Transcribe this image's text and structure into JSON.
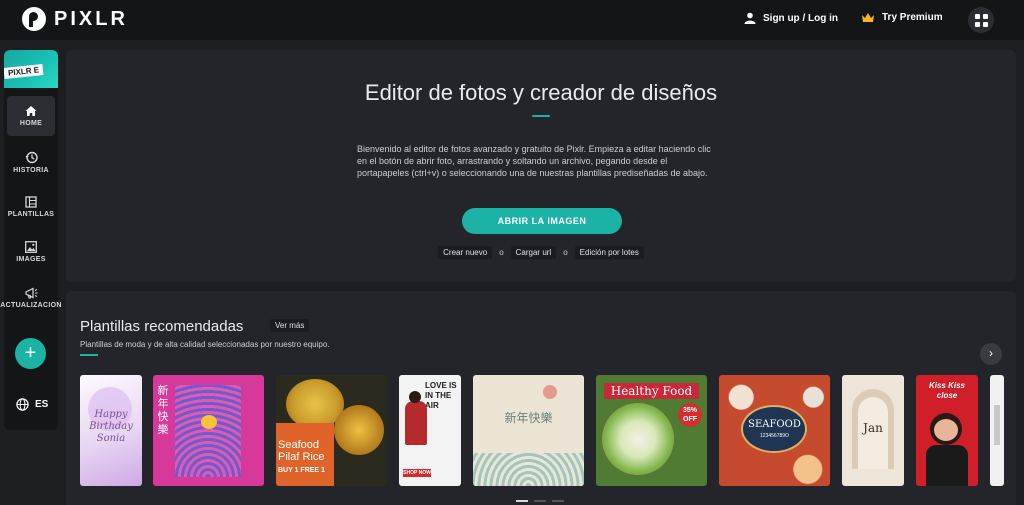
{
  "app": {
    "logo_text": "PIXLR"
  },
  "topbar": {
    "signup_label": "Sign up / Log in",
    "premium_label": "Try Premium"
  },
  "sidebar": {
    "brand_tag": "PIXLR E",
    "items": [
      {
        "label": "HOME",
        "icon": "home-icon"
      },
      {
        "label": "HISTORIA",
        "icon": "history-icon"
      },
      {
        "label": "PLANTILLAS",
        "icon": "templates-icon"
      },
      {
        "label": "IMAGES",
        "icon": "image-icon"
      },
      {
        "label": "ACTUALIZACION",
        "icon": "megaphone-icon"
      }
    ],
    "add_label": "+",
    "language": "ES"
  },
  "hero": {
    "title": "Editor de fotos y creador de diseños",
    "description": "Bienvenido al editor de fotos avanzado y gratuito de Pixlr. Empieza a editar haciendo clic en el botón de abrir foto, arrastrando y soltando un archivo, pegando desde el portapapeles (ctrl+v) o seleccionando una de nuestras plantillas prediseñadas de abajo.",
    "open_button": "ABRIR LA IMAGEN",
    "links": [
      "Crear nuevo",
      "Cargar url",
      "Edición por lotes"
    ],
    "separator": "o"
  },
  "templates": {
    "title": "Plantillas recomendadas",
    "see_more": "Ver más",
    "subtitle": "Plantillas de moda y de alta calidad seleccionadas por nuestro equipo.",
    "next_icon": "chevron-right-icon",
    "cards": [
      {
        "text": "Happy Birthday Sonia"
      },
      {
        "text": "新年快樂"
      },
      {
        "text": "Seafood Pilaf Rice",
        "sub": "BUY 1 FREE 1"
      },
      {
        "text": "LOVE IS IN THE AIR",
        "sub": "SHOP NOW"
      },
      {
        "text": "新年快樂"
      },
      {
        "text": "Healthy Food",
        "sub": "35% OFF"
      },
      {
        "text": "SEAFOOD",
        "sub": "123456789O"
      },
      {
        "text": "Jan"
      },
      {
        "text": "Kiss Kiss close"
      },
      {
        "text": ""
      }
    ]
  },
  "colors": {
    "accent": "#1ab3a6",
    "background": "#1d1e22",
    "panel": "#24252a",
    "topbar": "#141517"
  }
}
